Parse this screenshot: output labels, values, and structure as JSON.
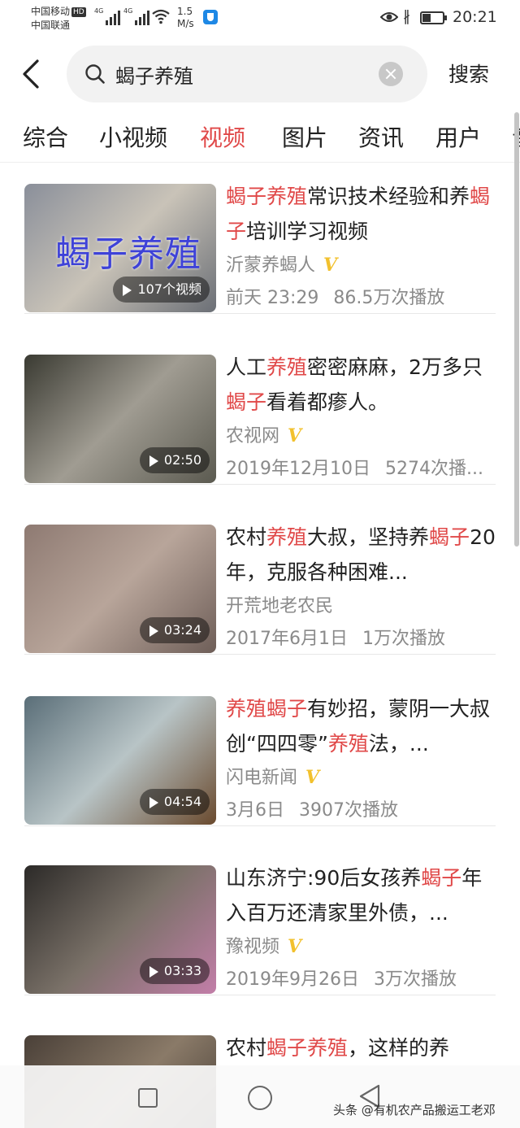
{
  "status_bar": {
    "carrier_1": "中国移动",
    "carrier_1_badge": "HD",
    "carrier_2": "中国联通",
    "signal_1_tag": "4G",
    "signal_2_tag": "4G",
    "net_speed": "1.5",
    "net_speed_unit": "M/s",
    "battery_level": 0.4,
    "time": "20:21",
    "icons": [
      "signal-icon",
      "wifi-icon",
      "shield-app-icon",
      "eye-icon",
      "bluetooth-icon",
      "battery-icon"
    ]
  },
  "search": {
    "query": "蝎子养殖",
    "submit_label": "搜索"
  },
  "tabs": [
    {
      "label": "综合",
      "active": false
    },
    {
      "label": "小视频",
      "active": false
    },
    {
      "label": "视频",
      "active": true
    },
    {
      "label": "图片",
      "active": false
    },
    {
      "label": "资讯",
      "active": false
    },
    {
      "label": "用户",
      "active": false
    },
    {
      "label": "音",
      "active": false
    }
  ],
  "results": [
    {
      "title_parts": [
        [
          "蝎子养殖",
          true
        ],
        [
          "常识技术经验和养",
          false
        ],
        [
          "蝎子",
          true
        ],
        [
          "培训学习视频",
          false
        ]
      ],
      "author": "沂蒙养蝎人",
      "verified": true,
      "date": "前天 23:29",
      "plays": "86.5万次播放",
      "badge": "107个视频",
      "thumb_text": "蝎子养殖",
      "thumb_colors": [
        "#8a8f9a",
        "#c9c3b8",
        "#6b6f76"
      ]
    },
    {
      "title_parts": [
        [
          "人工",
          false
        ],
        [
          "养殖",
          true
        ],
        [
          "密密麻麻，2万多只",
          false
        ],
        [
          "蝎子",
          true
        ],
        [
          "看着都瘆人。",
          false
        ]
      ],
      "author": "农视网",
      "verified": true,
      "date": "2019年12月10日",
      "plays": "5274次播...",
      "badge": "02:50",
      "thumb_text": "",
      "thumb_colors": [
        "#3a3a32",
        "#a09c92",
        "#5b5a50"
      ]
    },
    {
      "title_parts": [
        [
          "农村",
          false
        ],
        [
          "养殖",
          true
        ],
        [
          "大叔，坚持养",
          false
        ],
        [
          "蝎子",
          true
        ],
        [
          "20年，克服各种困难...",
          false
        ]
      ],
      "author": "开荒地老农民",
      "verified": false,
      "date": "2017年6月1日",
      "plays": "1万次播放",
      "badge": "03:24",
      "thumb_text": "",
      "thumb_colors": [
        "#8e7a72",
        "#b8a59a",
        "#6e5e58"
      ]
    },
    {
      "title_parts": [
        [
          "养殖蝎子",
          true
        ],
        [
          "有妙招，蒙阴一大叔创“四四零”",
          false
        ],
        [
          "养殖",
          true
        ],
        [
          "法，...",
          false
        ]
      ],
      "author": "闪电新闻",
      "verified": true,
      "date": "3月6日",
      "plays": "3907次播放",
      "badge": "04:54",
      "thumb_text": "",
      "thumb_colors": [
        "#5a6e78",
        "#b8c4c6",
        "#6a4a2e"
      ]
    },
    {
      "title_parts": [
        [
          "山东济宁:90后女孩养",
          false
        ],
        [
          "蝎子",
          true
        ],
        [
          "年入百万还清家里外债，...",
          false
        ]
      ],
      "author": "豫视频",
      "verified": true,
      "date": "2019年9月26日",
      "plays": "3万次播放",
      "badge": "03:33",
      "thumb_text": "",
      "thumb_colors": [
        "#2c2a28",
        "#7a7168",
        "#c27ea8"
      ]
    },
    {
      "title_parts": [
        [
          "农村",
          false
        ],
        [
          "蝎子养殖",
          true
        ],
        [
          "，这样的养",
          false
        ]
      ],
      "author": "",
      "verified": false,
      "date": "",
      "plays": "",
      "badge": "",
      "thumb_text": "",
      "thumb_colors": [
        "#4a4038",
        "#8a7a68",
        "#3a322c"
      ]
    }
  ],
  "bottom_nav": {
    "watermark": "头条 @有机农产品搬运工老邓"
  }
}
